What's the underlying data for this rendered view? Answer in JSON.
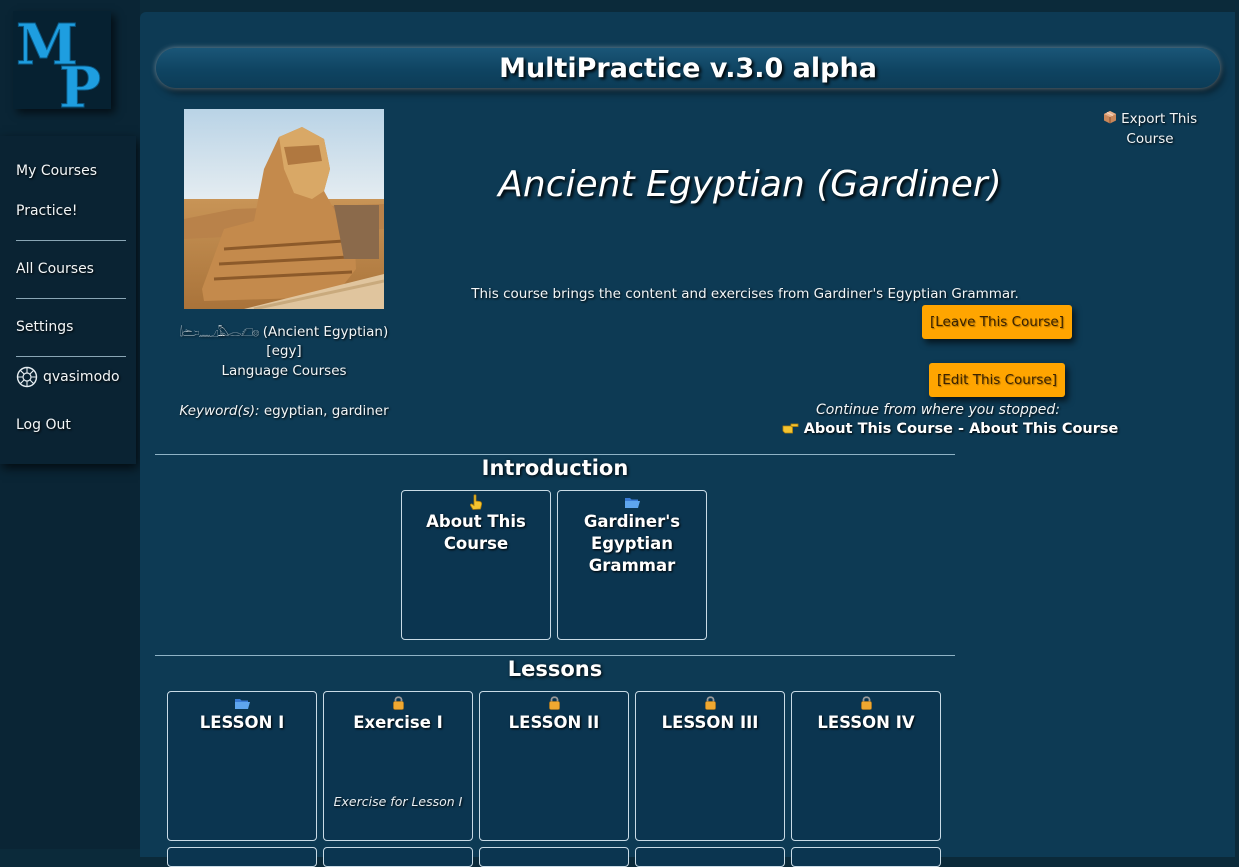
{
  "sidebar": {
    "logo": {
      "letter_top": "M",
      "letter_bottom": "P"
    },
    "items": [
      {
        "label": "My Courses"
      },
      {
        "label": "Practice!"
      },
      {
        "label": "All Courses"
      },
      {
        "label": "Settings"
      },
      {
        "label": "qvasimodo"
      },
      {
        "label": "Log Out"
      }
    ]
  },
  "header": {
    "title": "MultiPractice v.3.0 alpha"
  },
  "course": {
    "title": "Ancient Egyptian (Gardiner)",
    "description": "This course brings the content and exercises from Gardiner's Egyptian Grammar.",
    "language_glyphs": "𓌃𓂧𓈖𓈎𓅓𓂋𓆎𓊖",
    "language_name": "(Ancient Egyptian)",
    "language_code": "[egy]",
    "category": "Language Courses",
    "keywords_label": "Keyword(s):",
    "keywords": "egyptian, gardiner"
  },
  "actions": {
    "export_line1": "Export This",
    "export_line2": "Course",
    "leave": "[Leave This Course]",
    "edit": "[Edit This Course]"
  },
  "continue": {
    "label": "Continue from where you stopped:",
    "link": "About This Course - About This Course"
  },
  "sections": [
    {
      "title": "Introduction",
      "cards": [
        {
          "title": "About This Course",
          "icon": "pointing-hand-icon",
          "subtitle": ""
        },
        {
          "title": "Gardiner's Egyptian Grammar",
          "icon": "folder-open-icon",
          "subtitle": ""
        }
      ]
    },
    {
      "title": "Lessons",
      "cards": [
        {
          "title": "LESSON I",
          "icon": "folder-open-icon",
          "subtitle": ""
        },
        {
          "title": "Exercise I",
          "icon": "lock-icon",
          "subtitle": "Exercise for Lesson I"
        },
        {
          "title": "LESSON II",
          "icon": "lock-icon",
          "subtitle": ""
        },
        {
          "title": "LESSON III",
          "icon": "lock-icon",
          "subtitle": ""
        },
        {
          "title": "LESSON IV",
          "icon": "lock-icon",
          "subtitle": ""
        }
      ]
    }
  ],
  "colors": {
    "page_bg": "#0b2a3a",
    "panel_bg": "#0d3a54",
    "button_orange": "#ffa500",
    "logo_blue": "#1e9ee0"
  }
}
